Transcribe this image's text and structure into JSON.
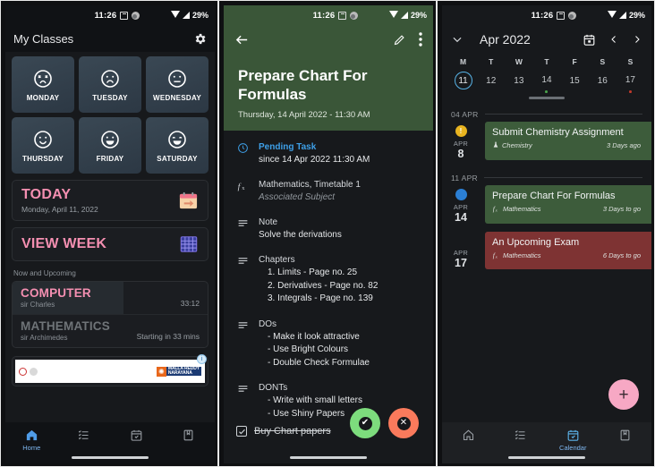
{
  "statusbar": {
    "time": "11:26",
    "battery": "29%",
    "icons": [
      "calendar-icon",
      "app-icon",
      "wifi-icon",
      "signal-icon"
    ]
  },
  "panel1": {
    "appbar": {
      "title": "My Classes",
      "settings_icon": "gear-icon"
    },
    "days": [
      {
        "name": "MONDAY",
        "face": "dead-face"
      },
      {
        "name": "TUESDAY",
        "face": "sad-face"
      },
      {
        "name": "WEDNESDAY",
        "face": "neutral-face"
      },
      {
        "name": "THURSDAY",
        "face": "slight-smile-face"
      },
      {
        "name": "FRIDAY",
        "face": "smile-face"
      },
      {
        "name": "SATURDAY",
        "face": "happy-face"
      }
    ],
    "today_card": {
      "title": "TODAY",
      "subtitle": "Monday, April 11, 2022",
      "icon": "calendar-arrow-icon"
    },
    "week_card": {
      "title": "VIEW WEEK",
      "icon": "grid-calendar-icon"
    },
    "section_label": "Now and Upcoming",
    "classes": [
      {
        "name": "COMPUTER",
        "teacher": "sir Charles",
        "right": "33:12",
        "state": "active",
        "progress": 57
      },
      {
        "name": "MATHEMATICS",
        "teacher": "sir Archimedes",
        "right": "Starting in 33 mins",
        "state": "idle",
        "progress": 0
      }
    ],
    "ad": {
      "brand_line1": "MALLA REDDY",
      "brand_line2": "NARAYANA",
      "badge": "i",
      "mark": "✺"
    },
    "nav": [
      {
        "label": "Home",
        "icon": "home-icon",
        "active": true
      },
      {
        "label": "",
        "icon": "list-icon",
        "active": false
      },
      {
        "label": "",
        "icon": "calendar-check-icon",
        "active": false
      },
      {
        "label": "",
        "icon": "book-icon",
        "active": false
      }
    ]
  },
  "panel2": {
    "toolbar": {
      "back_icon": "back-arrow-icon",
      "edit_icon": "pencil-icon",
      "more_icon": "more-vertical-icon"
    },
    "title": "Prepare Chart For Formulas",
    "date": "Thursday, 14 April 2022  -  11:30 AM",
    "rows": [
      {
        "icon": "pending-clock-icon",
        "head": "Pending Task",
        "head_accent": true,
        "sub": "since 14 Apr 2022 11:30 AM",
        "sub_muted": false
      },
      {
        "icon": "function-fx-icon",
        "head": "Mathematics, Timetable 1",
        "head_accent": false,
        "sub": "Associated Subject",
        "sub_muted": true
      },
      {
        "icon": "note-lines-icon",
        "head": "Note",
        "head_accent": false,
        "sub": "Solve the derivations",
        "sub_muted": false
      },
      {
        "icon": "note-lines-icon",
        "head": "Chapters",
        "head_accent": false,
        "list": [
          "1. Limits - Page no. 25",
          "2. Derivatives - Page no. 82",
          "3. Integrals - Page no. 139"
        ]
      },
      {
        "icon": "note-lines-icon",
        "head": "DOs",
        "head_accent": false,
        "list": [
          "- Make it look attractive",
          "- Use Bright Colours",
          "- Double Check Formulae"
        ]
      },
      {
        "icon": "note-lines-icon",
        "head": "DONTs",
        "head_accent": false,
        "list": [
          "- Write with small letters",
          "- Use Shiny Papers"
        ]
      }
    ],
    "checklist_item": {
      "label": "Buy Chart papers",
      "checked": true
    },
    "fabs": [
      {
        "name": "complete-task-fab",
        "glyph": "✔",
        "color": "#7ddc7d"
      },
      {
        "name": "dismiss-task-fab",
        "glyph": "✕",
        "color": "#fa7a5c"
      }
    ]
  },
  "panel3": {
    "appbar": {
      "expand_icon": "chevron-down-icon",
      "month": "Apr 2022",
      "today_icon": "calendar-today-icon",
      "prev_icon": "chevron-left-icon",
      "next_icon": "chevron-right-icon"
    },
    "dow": [
      "M",
      "T",
      "W",
      "T",
      "F",
      "S",
      "S"
    ],
    "dates": [
      {
        "num": "11",
        "selected": true,
        "dot": ""
      },
      {
        "num": "12",
        "selected": false,
        "dot": ""
      },
      {
        "num": "13",
        "selected": false,
        "dot": ""
      },
      {
        "num": "14",
        "selected": false,
        "dot": "#49a04a"
      },
      {
        "num": "15",
        "selected": false,
        "dot": ""
      },
      {
        "num": "16",
        "selected": false,
        "dot": ""
      },
      {
        "num": "17",
        "selected": false,
        "dot": "#c0392b"
      }
    ],
    "groups": [
      {
        "label": "04 APR",
        "events": [
          {
            "badge": "!",
            "badge_color": "#e8b420",
            "month": "APR",
            "day": "8",
            "title": "Submit Chemistry Assignment",
            "subject": "Chemistry",
            "subject_icon": "flask-icon",
            "when": "3 Days ago",
            "color": "green"
          }
        ]
      },
      {
        "label": "11 APR",
        "events": [
          {
            "badge": "◔",
            "badge_color": "#2b7fd4",
            "month": "APR",
            "day": "14",
            "title": "Prepare Chart For Formulas",
            "subject": "Mathematics",
            "subject_icon": "function-fx-icon",
            "when": "3 Days to go",
            "color": "green"
          },
          {
            "badge": "",
            "badge_color": "",
            "month": "APR",
            "day": "17",
            "title": "An Upcoming Exam",
            "subject": "Mathematics",
            "subject_icon": "function-fx-icon",
            "when": "6 Days to go",
            "color": "red"
          }
        ]
      }
    ],
    "fab": {
      "label": "+",
      "name": "add-event-fab"
    },
    "nav": [
      {
        "label": "",
        "icon": "home-icon",
        "active": false
      },
      {
        "label": "",
        "icon": "list-icon",
        "active": false
      },
      {
        "label": "Calendar",
        "icon": "calendar-check-icon",
        "active": true
      },
      {
        "label": "",
        "icon": "book-icon",
        "active": false
      }
    ]
  }
}
